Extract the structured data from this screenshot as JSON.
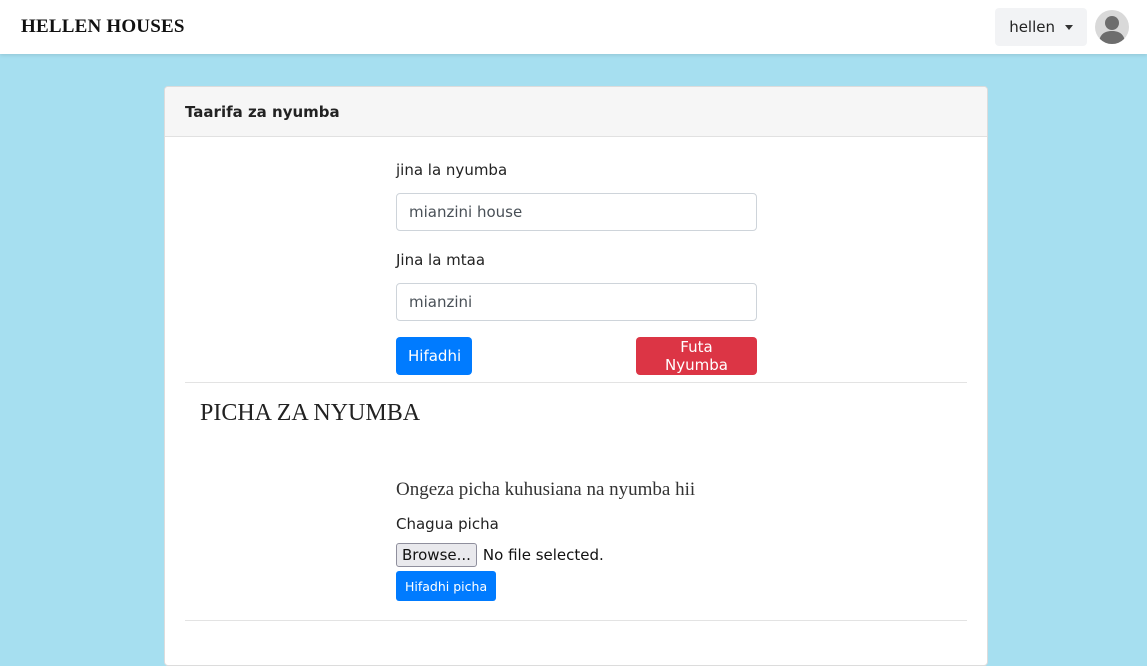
{
  "navbar": {
    "brand": "HELLEN HOUSES",
    "user_name": "hellen",
    "avatar_icon": "user-avatar-icon"
  },
  "card": {
    "header": "Taarifa za nyumba",
    "form": {
      "house_name_label": "jina la nyumba",
      "house_name_value": "mianzini house",
      "street_label": "Jina la mtaa",
      "street_value": "mianzini",
      "save_button": "Hifadhi",
      "delete_button": "Futa Nyumba"
    },
    "photos": {
      "section_title": "PICHA ZA NYUMBA",
      "upload_heading": "Ongeza picha kuhusiana na nyumba hii",
      "choose_label": "Chagua picha",
      "browse_button": "Browse...",
      "file_status": "No file selected.",
      "save_photo_button": "Hifadhi picha"
    }
  },
  "colors": {
    "background": "#a6dff0",
    "primary": "#007bff",
    "danger": "#dc3545"
  }
}
